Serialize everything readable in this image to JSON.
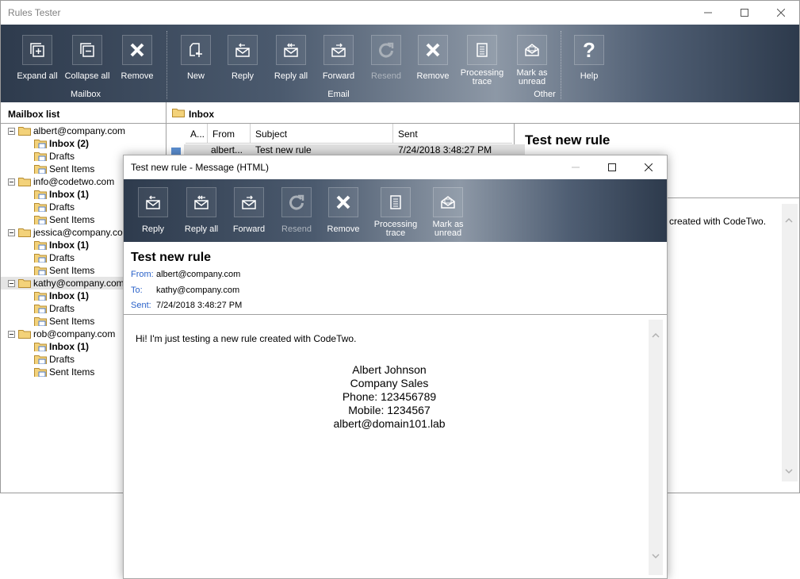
{
  "main_window": {
    "title": "Rules Tester",
    "ribbon": {
      "mailbox_group": {
        "label": "Mailbox",
        "buttons": [
          {
            "label": "Expand all",
            "icon": "expand-all-icon"
          },
          {
            "label": "Collapse all",
            "icon": "collapse-all-icon"
          },
          {
            "label": "Remove",
            "icon": "remove-x-icon"
          }
        ]
      },
      "email_group": {
        "label": "Email",
        "buttons": [
          {
            "label": "New",
            "icon": "new-message-icon"
          },
          {
            "label": "Reply",
            "icon": "reply-icon"
          },
          {
            "label": "Reply all",
            "icon": "reply-all-icon"
          },
          {
            "label": "Forward",
            "icon": "forward-icon"
          },
          {
            "label": "Resend",
            "icon": "resend-icon",
            "disabled": true
          },
          {
            "label": "Remove",
            "icon": "remove-x-icon"
          },
          {
            "label": "Processing trace",
            "icon": "trace-document-icon"
          },
          {
            "label": "Mark as unread",
            "icon": "mark-unread-icon"
          }
        ]
      },
      "other_group": {
        "label": "Other",
        "buttons": [
          {
            "label": "Help",
            "icon": "help-icon"
          }
        ]
      }
    },
    "mailbox_list": {
      "header": "Mailbox list",
      "mailboxes": [
        {
          "name": "albert@company.com",
          "folders": [
            "Inbox (2)",
            "Drafts",
            "Sent Items"
          ]
        },
        {
          "name": "info@codetwo.com",
          "folders": [
            "Inbox (1)",
            "Drafts",
            "Sent Items"
          ]
        },
        {
          "name": "jessica@company.com",
          "folders": [
            "Inbox (1)",
            "Drafts",
            "Sent Items"
          ]
        },
        {
          "name": "kathy@company.com",
          "folders": [
            "Inbox (1)",
            "Drafts",
            "Sent Items"
          ]
        },
        {
          "name": "rob@company.com",
          "folders": [
            "Inbox (1)",
            "Drafts",
            "Sent Items"
          ]
        }
      ]
    },
    "inbox": {
      "header": "Inbox",
      "columns": [
        "A...",
        "From",
        "Subject",
        "Sent"
      ],
      "rows": [
        {
          "from": "albert...",
          "subject": "Test new rule",
          "sent": "7/24/2018 3:48:27 PM"
        }
      ]
    },
    "preview": {
      "title": "Test new rule",
      "body_fragment": "created with CodeTwo."
    }
  },
  "message_window": {
    "title": "Test new rule - Message (HTML)",
    "ribbon_buttons": [
      {
        "label": "Reply",
        "icon": "reply-icon"
      },
      {
        "label": "Reply all",
        "icon": "reply-all-icon"
      },
      {
        "label": "Forward",
        "icon": "forward-icon"
      },
      {
        "label": "Resend",
        "icon": "resend-icon",
        "disabled": true
      },
      {
        "label": "Remove",
        "icon": "remove-x-icon"
      },
      {
        "label": "Processing trace",
        "icon": "trace-document-icon"
      },
      {
        "label": "Mark as unread",
        "icon": "mark-unread-icon"
      }
    ],
    "subject": "Test new rule",
    "from_label": "From:",
    "from": "albert@company.com",
    "to_label": "To:",
    "to": "kathy@company.com",
    "sent_label": "Sent:",
    "sent": "7/24/2018 3:48:27 PM",
    "body": "Hi! I'm just testing a new rule created with CodeTwo.",
    "signature": [
      "Albert Johnson",
      "Company Sales",
      "Phone: 123456789",
      "Mobile: 1234567",
      "albert@domain101.lab"
    ]
  },
  "colors": {
    "ribbon_dark": "#2e3b4d",
    "ribbon_light": "#8d98a6",
    "header_link_blue": "#2a62c9",
    "selection_gray": "#e5e5e5"
  }
}
